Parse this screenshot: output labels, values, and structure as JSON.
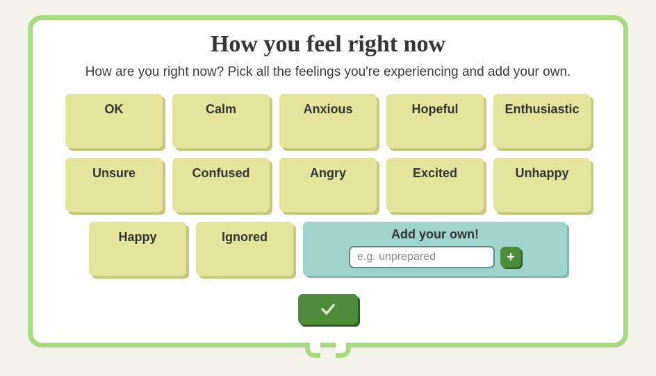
{
  "title": "How you feel right now",
  "subtitle": "How are you right now? Pick all the feelings you're experiencing and add your own.",
  "feelings": [
    "OK",
    "Calm",
    "Anxious",
    "Hopeful",
    "Enthusiastic",
    "Unsure",
    "Confused",
    "Angry",
    "Excited",
    "Unhappy",
    "Happy",
    "Ignored"
  ],
  "addOwn": {
    "label": "Add your own!",
    "placeholder": "e.g. unprepared",
    "value": ""
  },
  "colors": {
    "panelBorder": "#a8da81",
    "chipBg": "#e3e59d",
    "chipShadow": "#c6c87b",
    "addOwnBg": "#9ed4cc",
    "submitBg": "#4e8b3a"
  }
}
